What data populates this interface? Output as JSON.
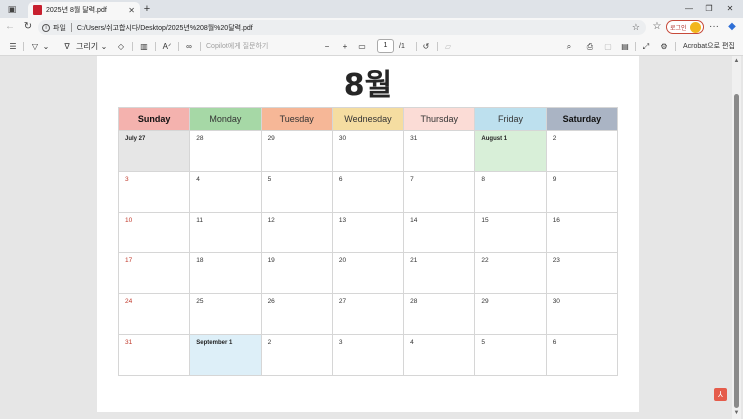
{
  "browser": {
    "tab_title": "2025년 8월 달력.pdf",
    "tab_close": "✕",
    "new_tab": "+",
    "window_controls": [
      "—",
      "❐",
      "✕"
    ],
    "nav": {
      "back": "←",
      "refresh": "↻"
    },
    "info_label": "파일",
    "url": "C:/Users/쉬고합시다/Desktop/2025년%208월%20달력.pdf",
    "star": "☆",
    "profile_label": "로그인",
    "more": "···"
  },
  "pdf_toolbar": {
    "draw_label": "그리기",
    "copilot_placeholder": "Copilot에게 질문하기",
    "zoom_out": "−",
    "zoom_in": "+",
    "page_current": "1",
    "page_total": "/1",
    "acrobat_label": "Acrobat으로 편집"
  },
  "calendar": {
    "month_title": "8월",
    "headers": [
      "Sunday",
      "Monday",
      "Tuesday",
      "Wednesday",
      "Thursday",
      "Friday",
      "Saturday"
    ],
    "header_colors": [
      "#f4b2ae",
      "#a6d8a6",
      "#f6b797",
      "#f5dda1",
      "#fbdcd6",
      "#bde0ee",
      "#aab4c4"
    ],
    "weeks": [
      [
        "July 27",
        "28",
        "29",
        "30",
        "31",
        "August 1",
        "2"
      ],
      [
        "3",
        "4",
        "5",
        "6",
        "7",
        "8",
        "9"
      ],
      [
        "10",
        "11",
        "12",
        "13",
        "14",
        "15",
        "16"
      ],
      [
        "17",
        "18",
        "19",
        "20",
        "21",
        "22",
        "23"
      ],
      [
        "24",
        "25",
        "26",
        "27",
        "28",
        "29",
        "30"
      ],
      [
        "31",
        "September 1",
        "2",
        "3",
        "4",
        "5",
        "6"
      ]
    ],
    "special_cell_colors": {
      "july27": "#e6e6e6",
      "aug1": "#d8efd8",
      "sep1": "#ddeff8"
    }
  }
}
